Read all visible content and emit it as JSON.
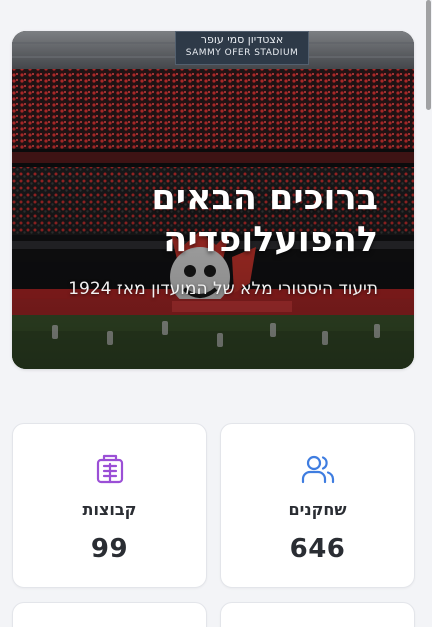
{
  "hero": {
    "stadium_sign_he": "אצטדיון סמי עופר",
    "stadium_sign_en": "SAMMY OFER STADIUM",
    "title": "ברוכים הבאים להפועלופדיה",
    "subtitle": "תיעוד היסטורי מלא של המועדון מאז 1924"
  },
  "stats": [
    {
      "label": "שחקנים",
      "value": "646",
      "icon": "users-icon",
      "color": "#3f7de0"
    },
    {
      "label": "קבוצות",
      "value": "99",
      "icon": "building-icon",
      "color": "#9b4fd6"
    }
  ]
}
